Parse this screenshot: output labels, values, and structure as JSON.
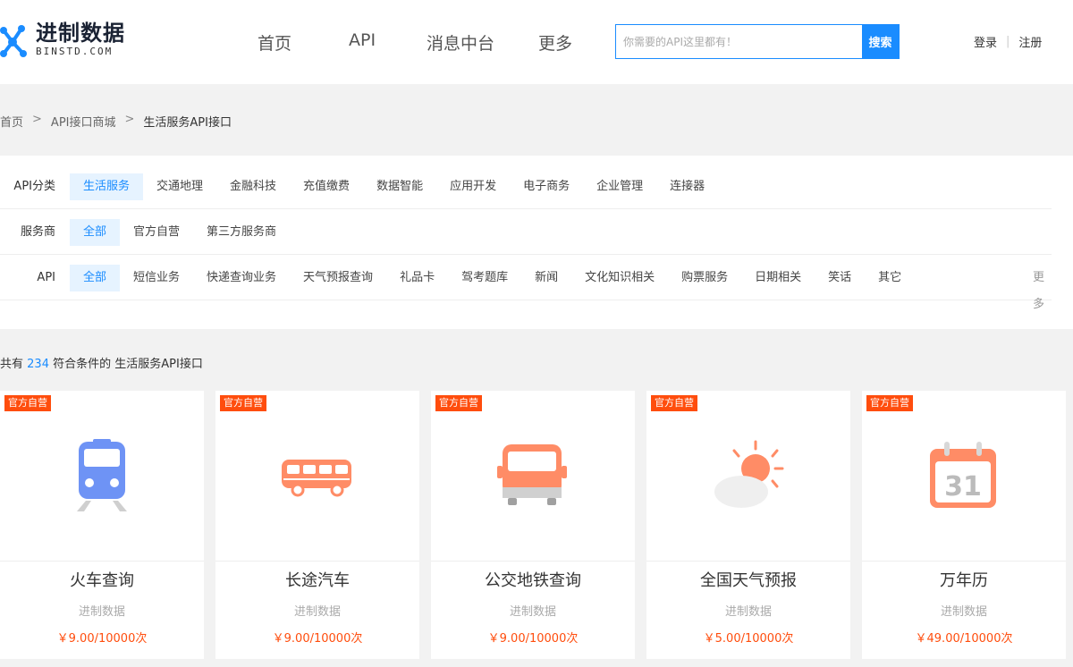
{
  "header": {
    "logo_title": "进制数据",
    "logo_sub": "BINSTD.COM",
    "nav": [
      "首页",
      "API",
      "消息中台",
      "更多"
    ],
    "search_placeholder": "你需要的API这里都有！",
    "search_button": "搜索",
    "login": "登录",
    "register": "注册",
    "auth_sep": "|"
  },
  "breadcrumb": {
    "items": [
      "首页",
      "API接口商城",
      "生活服务API接口"
    ],
    "separator": ">"
  },
  "filters": {
    "category": {
      "label": "API分类",
      "options": [
        "生活服务",
        "交通地理",
        "金融科技",
        "充值缴费",
        "数据智能",
        "应用开发",
        "电子商务",
        "企业管理",
        "连接器"
      ],
      "active": 0
    },
    "provider": {
      "label": "服务商",
      "options": [
        "全部",
        "官方自营",
        "第三方服务商"
      ],
      "active": 0
    },
    "api": {
      "label": "API",
      "options": [
        "全部",
        "短信业务",
        "快递查询业务",
        "天气预报查询",
        "礼品卡",
        "驾考题库",
        "新闻",
        "文化知识相关",
        "购票服务",
        "日期相关",
        "笑话",
        "其它"
      ],
      "active": 0,
      "more": "更多"
    }
  },
  "result": {
    "prefix": "共有",
    "count": "234",
    "suffix": "符合条件的 生活服务API接口"
  },
  "cards": [
    {
      "badge": "官方自营",
      "name": "火车查询",
      "vendor": "进制数据",
      "price": "￥9.00/10000次",
      "icon": "train-icon"
    },
    {
      "badge": "官方自营",
      "name": "长途汽车",
      "vendor": "进制数据",
      "price": "￥9.00/10000次",
      "icon": "coach-bus-icon"
    },
    {
      "badge": "官方自营",
      "name": "公交地铁查询",
      "vendor": "进制数据",
      "price": "￥9.00/10000次",
      "icon": "city-bus-icon"
    },
    {
      "badge": "官方自营",
      "name": "全国天气预报",
      "vendor": "进制数据",
      "price": "￥5.00/10000次",
      "icon": "weather-icon"
    },
    {
      "badge": "官方自营",
      "name": "万年历",
      "vendor": "进制数据",
      "price": "￥49.00/10000次",
      "icon": "calendar-icon",
      "calendar_day": "31"
    }
  ],
  "colors": {
    "accent": "#1a8cff",
    "badge": "#ff4d0d",
    "price": "#ff4d0d",
    "icon_blue": "#6e93f5",
    "icon_orange": "#ff8c66"
  }
}
